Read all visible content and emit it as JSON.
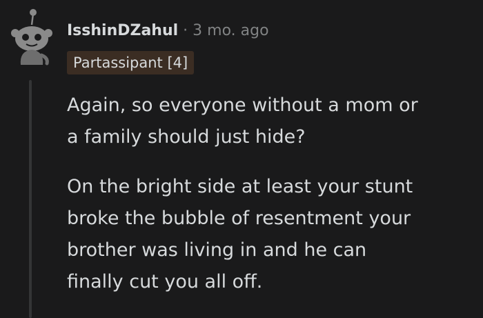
{
  "comment": {
    "author": "IsshinDZahul",
    "separator": "·",
    "time": "3 mo. ago",
    "flair": "Partassipant [4]",
    "paragraphs": [
      "Again, so everyone without a mom or\na family should just hide?",
      "On the bright side at least your stunt\nbroke the bubble of resentment your\nbrother was living in and he can\nfinally cut you all off."
    ]
  },
  "avatar": {
    "icon": "snoo-avatar-icon",
    "colors": {
      "face": "#8a8a8a",
      "body": "#6e6e6e",
      "eyes": "#1a1a1b",
      "antenna": "#8a8a8a"
    }
  },
  "colors": {
    "background": "#1a1a1b",
    "text": "#d7dadc",
    "muted": "#818384",
    "flair_bg": "#3b2d23",
    "thread_line": "#343536"
  }
}
